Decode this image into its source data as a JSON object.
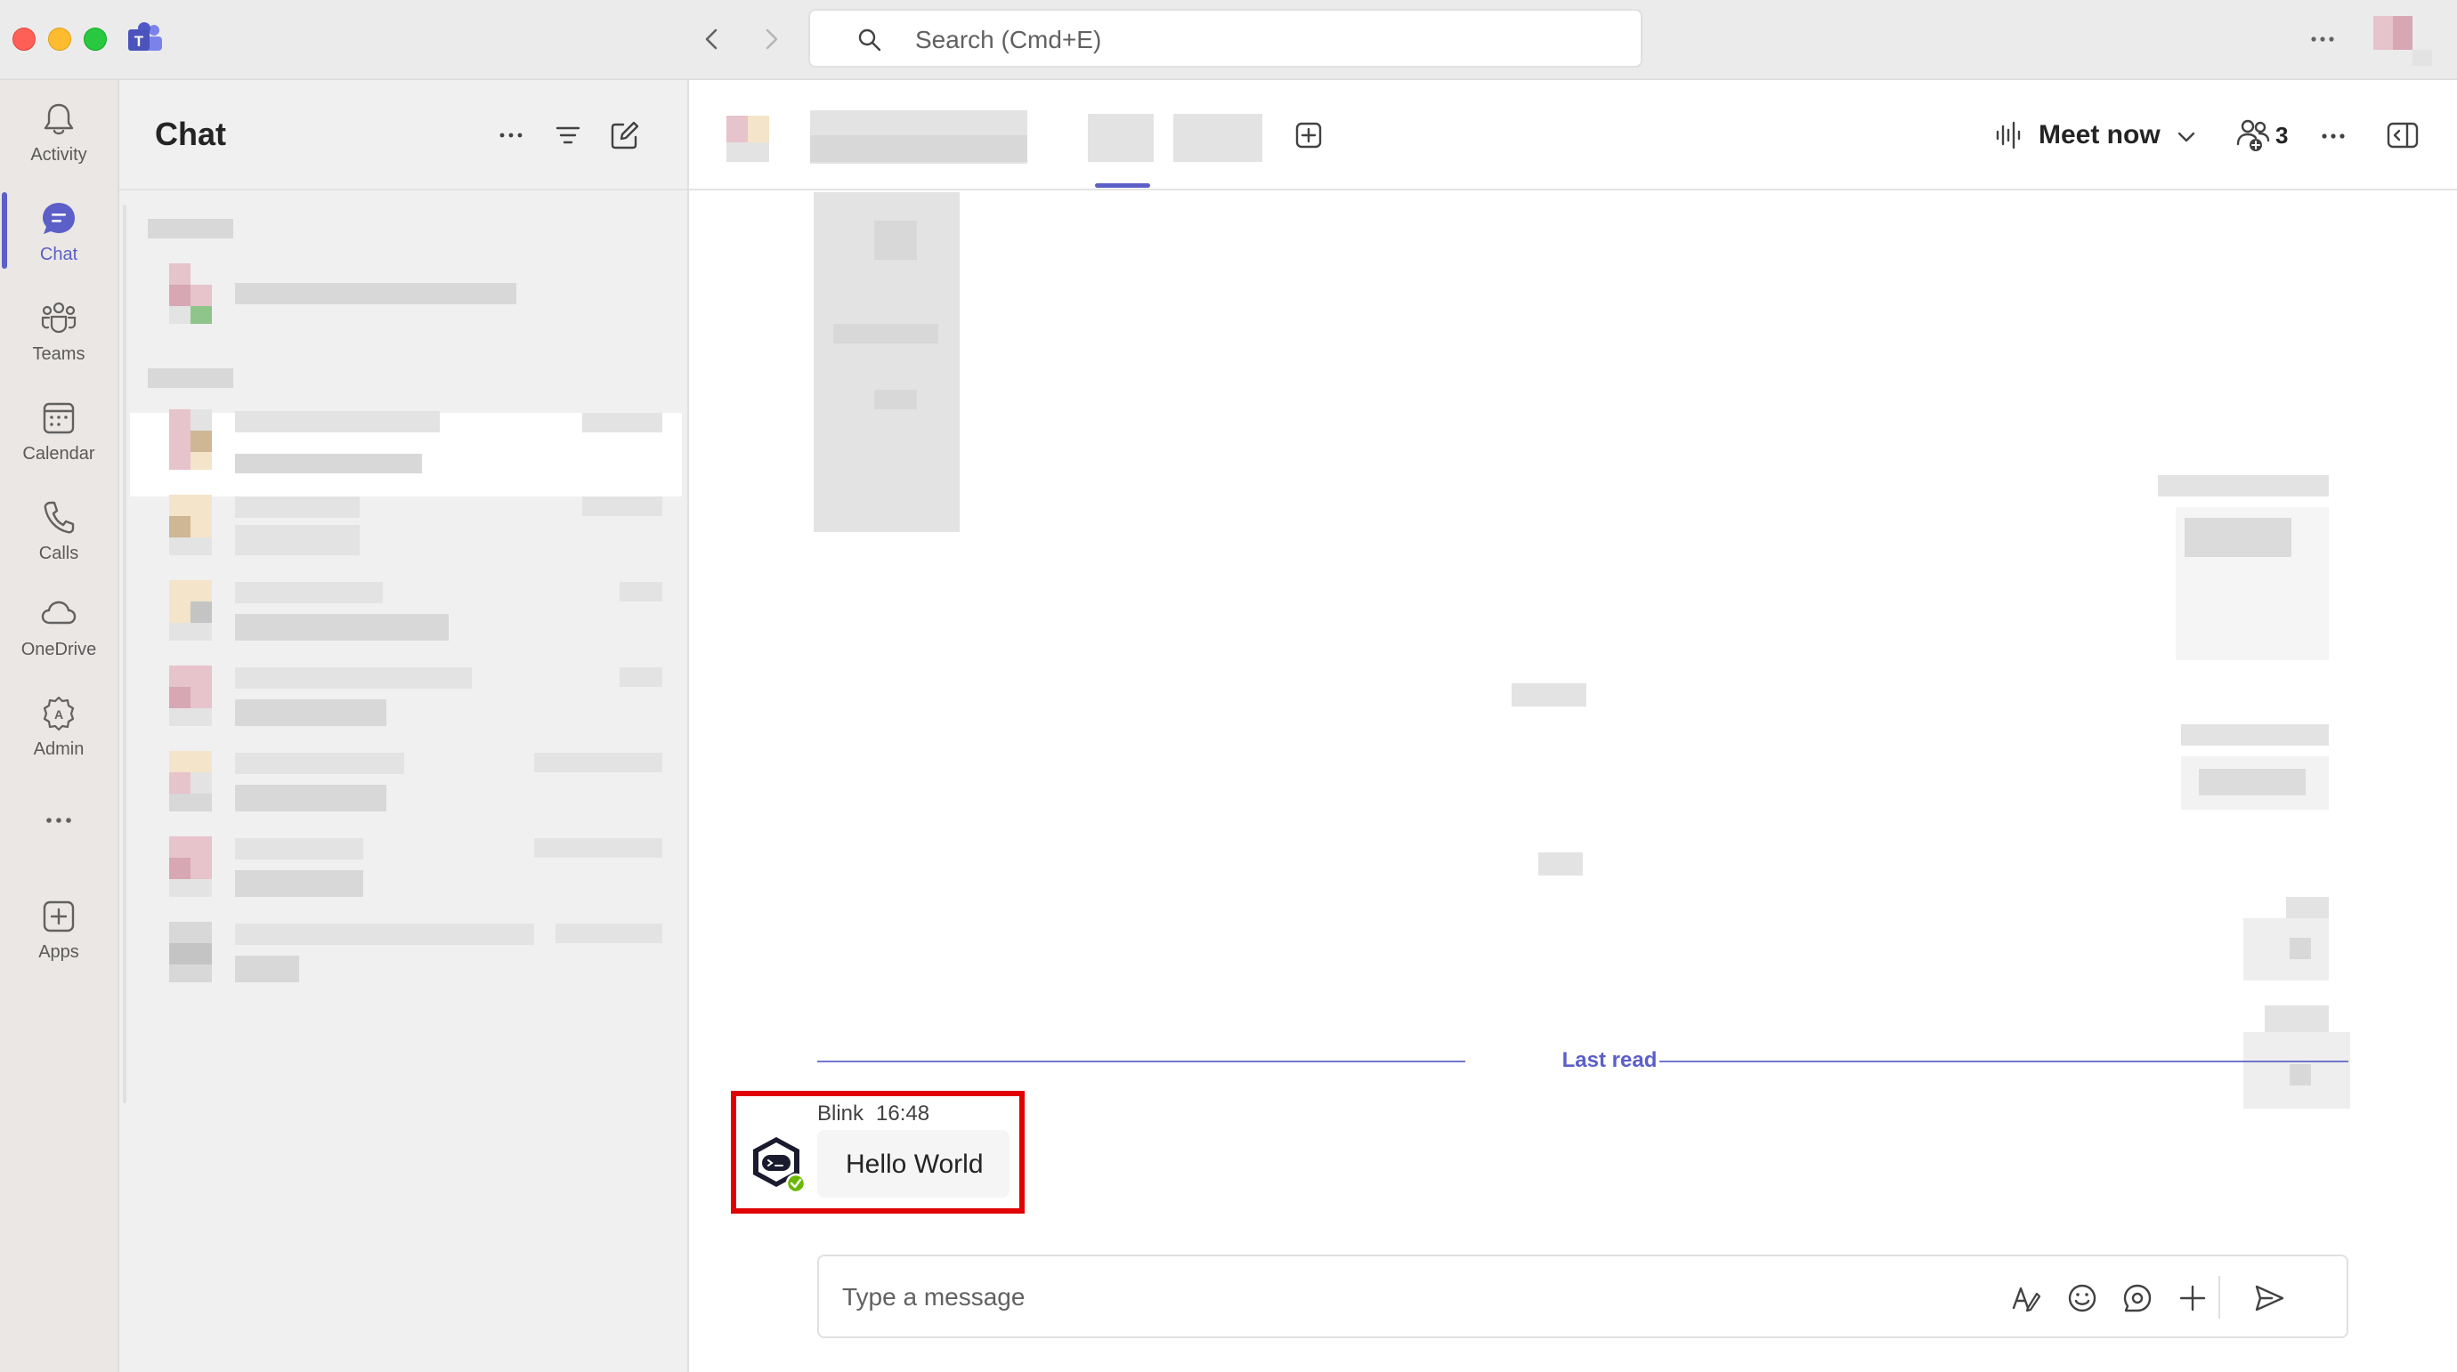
{
  "titlebar": {
    "search_placeholder": "Search (Cmd+E)"
  },
  "rail": {
    "items": [
      {
        "label": "Activity",
        "icon": "bell-icon"
      },
      {
        "label": "Chat",
        "icon": "chat-icon",
        "active": true
      },
      {
        "label": "Teams",
        "icon": "teams-icon"
      },
      {
        "label": "Calendar",
        "icon": "calendar-icon"
      },
      {
        "label": "Calls",
        "icon": "phone-icon"
      },
      {
        "label": "OneDrive",
        "icon": "cloud-icon"
      },
      {
        "label": "Admin",
        "icon": "admin-icon"
      },
      {
        "label": "",
        "icon": "more-icon"
      },
      {
        "label": "Apps",
        "icon": "apps-icon"
      }
    ]
  },
  "chatlist": {
    "title": "Chat"
  },
  "main": {
    "meet_now_label": "Meet now",
    "participant_count": "3",
    "last_read_label": "Last read",
    "message": {
      "sender": "Blink",
      "time": "16:48",
      "text": "Hello World"
    },
    "composer_placeholder": "Type a message"
  },
  "colors": {
    "accent": "#5b5fc7",
    "highlight": "#e00000",
    "presence_available": "#6bb700"
  }
}
